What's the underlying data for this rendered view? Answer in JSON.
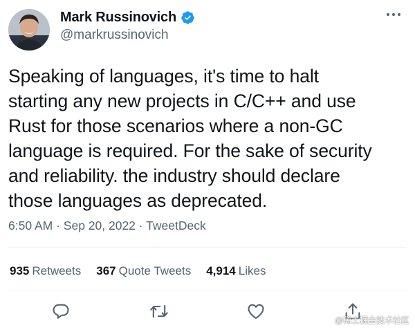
{
  "author": {
    "display_name": "Mark Russinovich",
    "handle": "@markrussinovich",
    "verified": true,
    "verified_color": "#1d9bf0",
    "avatar_icon": "profile-photo"
  },
  "tweet": {
    "text_lines": [
      "Speaking of languages, it's time to halt",
      "starting any new projects in C/C++ and use",
      "Rust for those scenarios where a non-GC",
      "language is required. For the sake of security",
      "and reliability. the industry should declare",
      "those languages as deprecated."
    ],
    "time": "6:50 AM",
    "date": "Sep 20, 2022",
    "source": "TweetDeck",
    "separator": "·"
  },
  "stats": {
    "retweets": {
      "count": "935",
      "label": "Retweets"
    },
    "quote_tweets": {
      "count": "367",
      "label": "Quote Tweets"
    },
    "likes": {
      "count": "4,914",
      "label": "Likes"
    }
  },
  "actions": {
    "icons": [
      "reply-icon",
      "retweet-icon",
      "like-icon",
      "share-icon"
    ]
  },
  "menu": {
    "icon": "more-options-icon"
  },
  "watermark": {
    "text": "@稀土掘金技术社区"
  },
  "colors": {
    "text_primary": "#0f1419",
    "text_secondary": "#536471",
    "divider": "#eff3f4"
  }
}
